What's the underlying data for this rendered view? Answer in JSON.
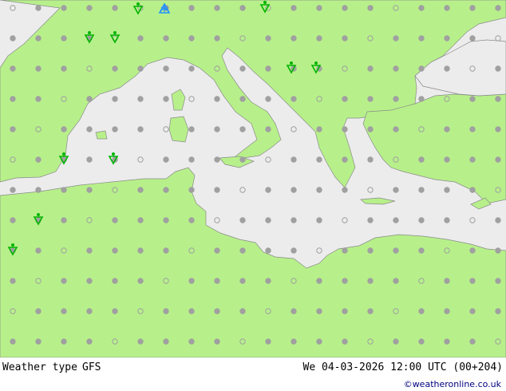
{
  "footer": {
    "legend_label": "Weather type",
    "model_label": "GFS",
    "datetime": "We 04-03-2026 12:00 UTC (00+204)",
    "credit": "©weatheronline.co.uk"
  },
  "colors": {
    "land": "#b7f08a",
    "sea": "#ececec",
    "border": "#9a9a9a",
    "coast": "#8a8a8a",
    "dot": "#a0a0a0",
    "drizzle_symbol": "#00b400",
    "snow_symbol": "#1e90ff"
  },
  "symbols": [
    {
      "type": "drizzle-showers",
      "count": 10
    },
    {
      "type": "snow-showers",
      "count": 1
    }
  ]
}
